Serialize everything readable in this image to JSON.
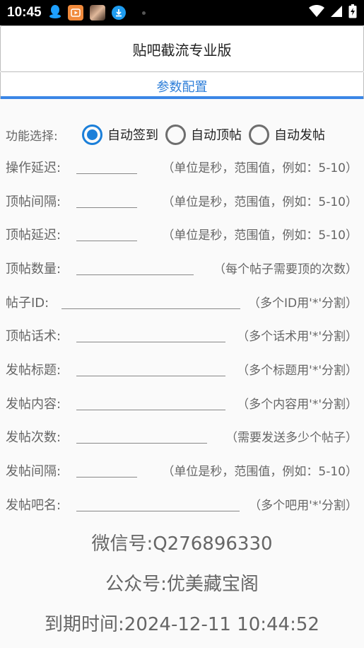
{
  "status_bar": {
    "time": "10:45",
    "icons": [
      "qq-icon",
      "video-app-icon",
      "avatar-app-icon",
      "download-icon"
    ],
    "right_icons": [
      "wifi-icon",
      "signal-icon",
      "battery-charging-icon"
    ]
  },
  "app": {
    "title": "贴吧截流专业版"
  },
  "tabs": [
    {
      "label": "参数配置",
      "active": true
    }
  ],
  "accent_color": "#3a86e6",
  "function_select": {
    "label": "功能选择:",
    "options": [
      {
        "label": "自动签到",
        "checked": true
      },
      {
        "label": "自动顶帖",
        "checked": false
      },
      {
        "label": "自动发帖",
        "checked": false
      }
    ]
  },
  "fields": [
    {
      "label": "操作延迟:",
      "value": "",
      "hint": "（单位是秒，范围值，例如：5-10）"
    },
    {
      "label": "顶帖间隔:",
      "value": "",
      "hint": "（单位是秒，范围值，例如：5-10）"
    },
    {
      "label": "顶帖延迟:",
      "value": "",
      "hint": "（单位是秒，范围值，例如：5-10）"
    },
    {
      "label": "顶帖数量:",
      "value": "",
      "hint": "（每个帖子需要顶的次数）"
    },
    {
      "label": "帖子ID:",
      "value": "",
      "hint": "（多个ID用'*'分割）"
    },
    {
      "label": "顶帖话术:",
      "value": "",
      "hint": "（多个话术用'*'分割）"
    },
    {
      "label": "发帖标题:",
      "value": "",
      "hint": "（多个标题用'*'分割）"
    },
    {
      "label": "发帖内容:",
      "value": "",
      "hint": "（多个内容用'*'分割）"
    },
    {
      "label": "发帖次数:",
      "value": "",
      "hint": "（需要发送多少个帖子）"
    },
    {
      "label": "发帖间隔:",
      "value": "",
      "hint": "（单位是秒，范围值，例如：5-10）"
    },
    {
      "label": "发帖吧名:",
      "value": "",
      "hint": "（多个吧用'*'分割）"
    }
  ],
  "info": {
    "wechat": "微信号:Q276896330",
    "official_account": "公众号:优美藏宝阁",
    "expiry": "到期时间:2024-12-11 10:44:52"
  }
}
